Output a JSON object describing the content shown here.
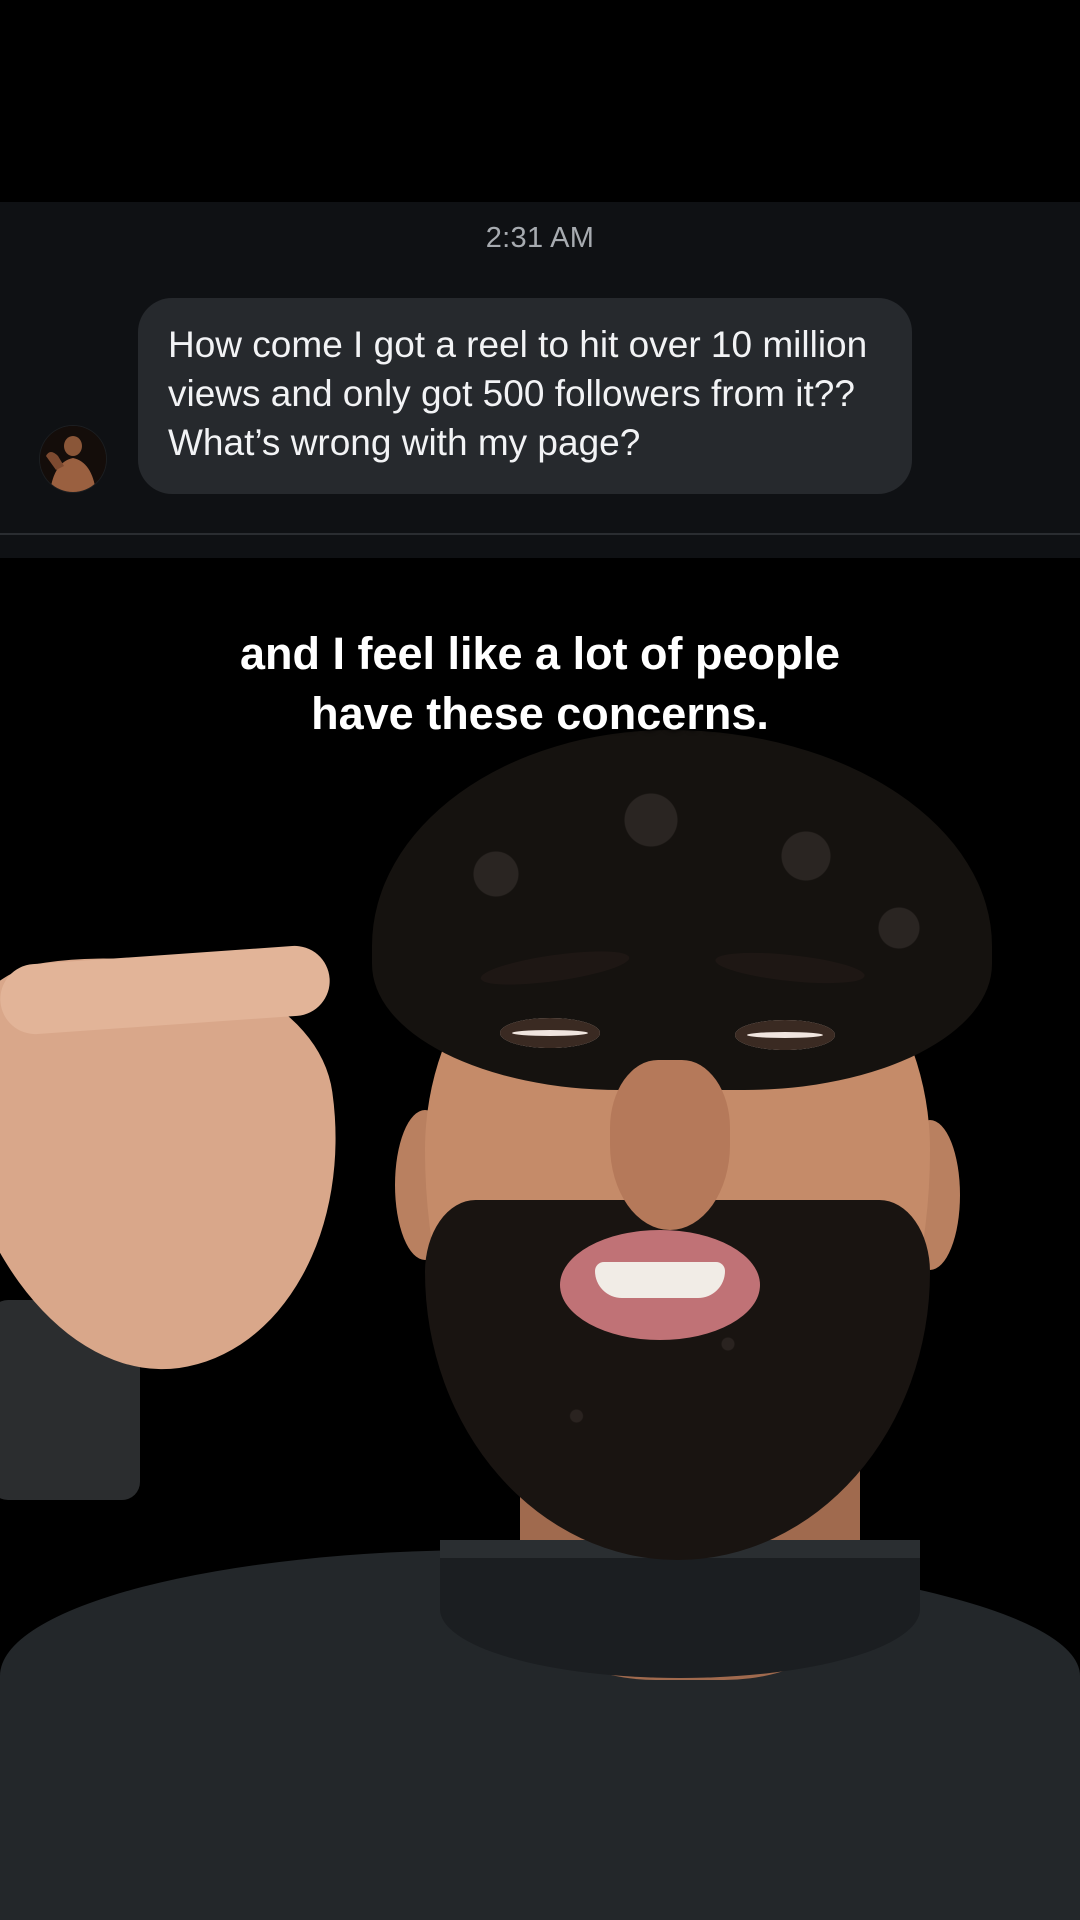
{
  "dm": {
    "timestamp": "2:31 AM",
    "message": "How come I got a reel to hit over 10 million views and only got 500 followers from it?? What’s wrong with my page?",
    "avatar_icon": "user-avatar-photo"
  },
  "caption": {
    "line1": "and I feel like a lot of people",
    "line2": "have these concerns."
  },
  "colors": {
    "background": "#000000",
    "dm_panel": "#0f1114",
    "bubble": "#26292d",
    "timestamp_text": "#a7abb0",
    "caption_text": "#ffffff"
  }
}
